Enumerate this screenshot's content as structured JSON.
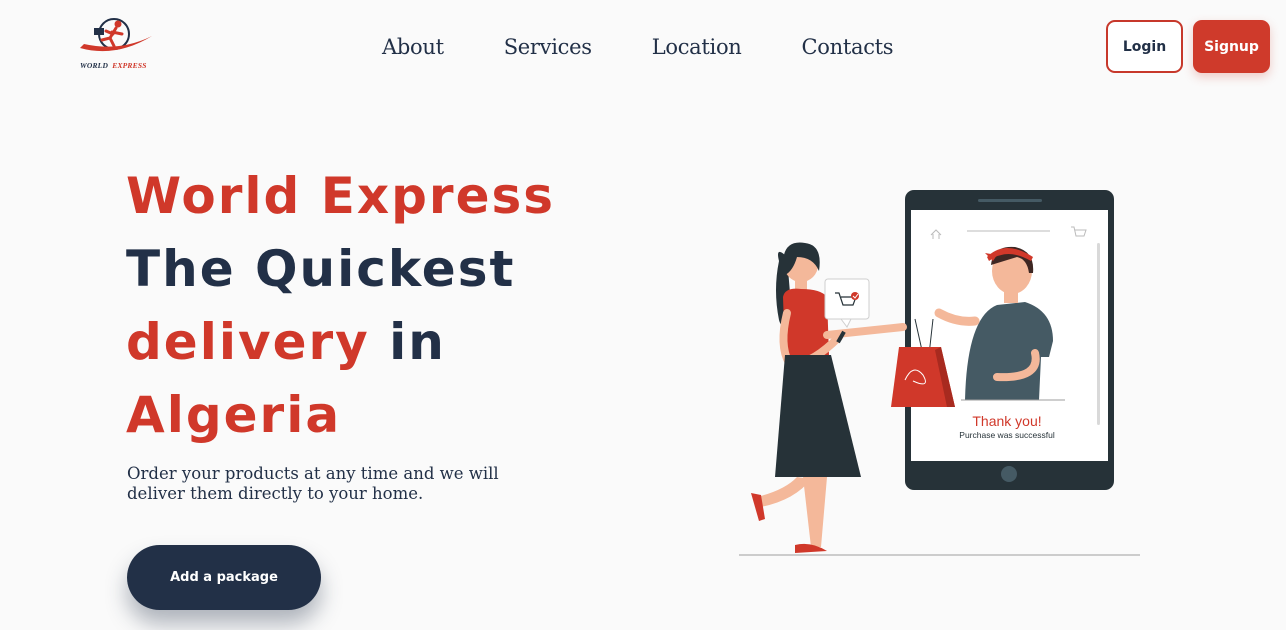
{
  "brand": {
    "logo_word1": "WORLD",
    "logo_word2": "EXPRESS"
  },
  "nav": {
    "items": [
      {
        "label": "About"
      },
      {
        "label": "Services"
      },
      {
        "label": "Location"
      },
      {
        "label": "Contacts"
      }
    ]
  },
  "auth": {
    "login_label": "Login",
    "signup_label": "Signup"
  },
  "hero": {
    "line1": "World Express",
    "line2": "The Quickest",
    "line3_red": "delivery",
    "line3_navy": " in",
    "line4": "Algeria",
    "description": "Order your products at any time and we will deliver them directly to your home.",
    "cta_label": "Add a package"
  },
  "illustration": {
    "thank_you": "Thank you!",
    "purchase_text": "Purchase was successful"
  },
  "colors": {
    "accent": "#d0382a",
    "navy": "#223047",
    "background": "#fafafa"
  }
}
